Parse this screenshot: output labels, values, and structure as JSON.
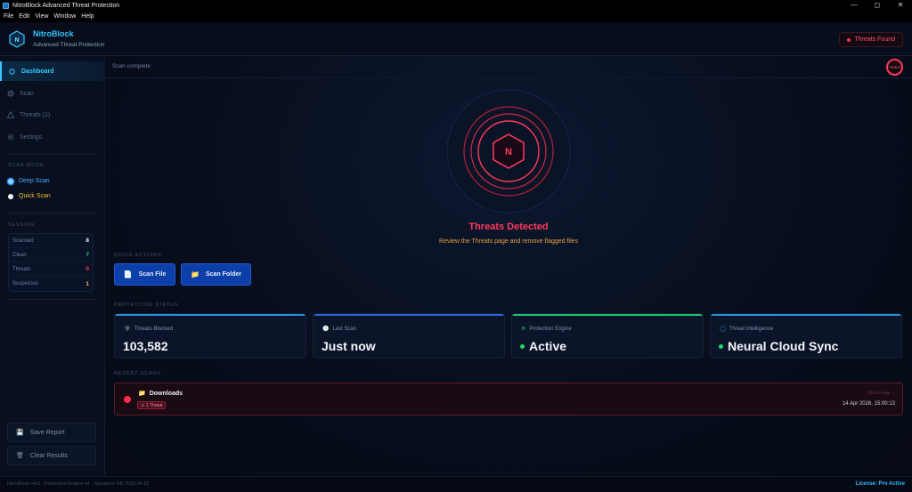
{
  "window": {
    "title": "NitroBlock Advanced Threat Protection",
    "menu": [
      "File",
      "Edit",
      "View",
      "Window",
      "Help"
    ],
    "controls": [
      "—",
      "◻",
      "✕"
    ]
  },
  "header": {
    "brand": "NitroBlock",
    "tagline": "Advanced Threat Protection",
    "logo_letter": "N",
    "threat_pill": "Threats Found"
  },
  "sidebar": {
    "nav": [
      {
        "label": "Dashboard",
        "icon": "circle-icon"
      },
      {
        "label": "Scan",
        "icon": "crosshair-icon"
      },
      {
        "label": "Threats (1)",
        "icon": "warning-icon"
      },
      {
        "label": "Settings",
        "icon": "gear-icon"
      }
    ],
    "scan_mode_label": "SCAN MODE",
    "modes": [
      {
        "label": "Deep Scan",
        "color": "#4fa8ff"
      },
      {
        "label": "Quick Scan",
        "color": "#f5b830"
      }
    ],
    "session_label": "SESSION",
    "session": [
      {
        "label": "Scanned",
        "value": "8",
        "color": "#e8eef8"
      },
      {
        "label": "Clean",
        "value": "7",
        "color": "#22d46b"
      },
      {
        "label": "Threats",
        "value": "0",
        "color": "#ff3a5c"
      },
      {
        "label": "Suspicious",
        "value": "1",
        "color": "#f5b830"
      }
    ],
    "save_report": "Save Report",
    "clear_results": "Clear Results"
  },
  "main": {
    "scan_status": "Scan complete",
    "status_ring": "THREAT",
    "center_letter": "N",
    "headline": "Threats Detected",
    "subline": "Review the Threats page and remove flagged files",
    "quick_actions_label": "QUICK ACTIONS",
    "scan_file": "Scan File",
    "scan_folder": "Scan Folder",
    "protection_label": "PROTECTION STATUS",
    "cards": [
      {
        "title": "Threats Blocked",
        "value": "103,582",
        "icon": "shield-icon",
        "bar": "#2a8fd8"
      },
      {
        "title": "Last Scan",
        "value": "Just now",
        "icon": "clock-icon",
        "bar": "#2a62d8"
      },
      {
        "title": "Protection Engine",
        "value": "Active",
        "icon": "engine-icon",
        "bar": "#1fbf6a"
      },
      {
        "title": "Threat Intelligence",
        "value": "Neural Cloud Sync",
        "icon": "globe-icon",
        "bar": "#2a8fd8"
      }
    ],
    "recent_label": "RECENT SCANS",
    "recent": {
      "name": "Downloads",
      "badge": "⚠ 1 Threat",
      "tag": "Click to view →",
      "time": "14 Apr 2026, 15:00:13"
    }
  },
  "footer": {
    "left": "NitroBlock v4.5 · Protection Engine v4 · Signature DB 2026.04.15",
    "right": "License: Pro Active"
  }
}
